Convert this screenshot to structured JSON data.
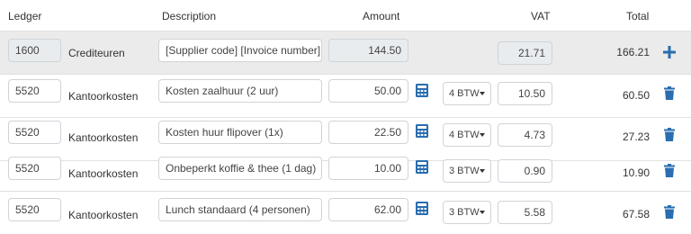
{
  "headers": {
    "ledger": "Ledger",
    "description": "Description",
    "amount": "Amount",
    "vat": "VAT",
    "total": "Total"
  },
  "colors": {
    "accent": "#2a6db0",
    "border": "#cfd4d9",
    "readonly_bg": "#e9ecef",
    "header_row_bg": "#ebebeb"
  },
  "first_row": {
    "ledger": "1600",
    "ledger_name": "Crediteuren",
    "description": "[Supplier code] [Invoice number]",
    "amount": "144.50",
    "vat": "21.71",
    "total": "166.21",
    "action_icon": "plus-icon"
  },
  "lines": [
    {
      "ledger": "5520",
      "ledger_name": "Kantoorkosten",
      "description": "Kosten zaalhuur (2 uur)",
      "amount": "50.00",
      "vat_code": "4 BTW",
      "vat": "10.50",
      "total": "60.50",
      "calc_icon": "calculator-icon",
      "action_icon": "trash-icon"
    },
    {
      "ledger": "5520",
      "ledger_name": "Kantoorkosten",
      "description": "Kosten huur flipover (1x)",
      "amount": "22.50",
      "vat_code": "4 BTW",
      "vat": "4.73",
      "total": "27.23",
      "calc_icon": "calculator-icon",
      "action_icon": "trash-icon"
    },
    {
      "ledger": "5520",
      "ledger_name": "Kantoorkosten",
      "description": "Onbeperkt koffie & thee (1 dag)",
      "amount": "10.00",
      "vat_code": "3 BTW",
      "vat": "0.90",
      "total": "10.90",
      "calc_icon": "calculator-icon",
      "action_icon": "trash-icon"
    },
    {
      "ledger": "5520",
      "ledger_name": "Kantoorkosten",
      "description": "Lunch standaard (4 personen)",
      "amount": "62.00",
      "vat_code": "3 BTW",
      "vat": "5.58",
      "total": "67.58",
      "calc_icon": "calculator-icon",
      "action_icon": "trash-icon"
    }
  ]
}
